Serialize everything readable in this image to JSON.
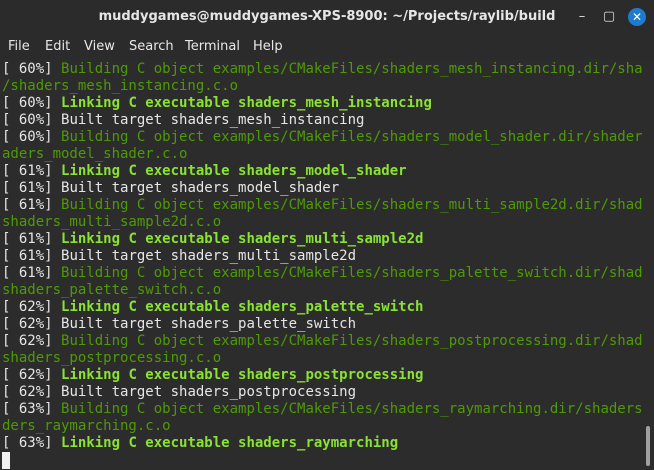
{
  "window": {
    "title": "muddygames@muddygames-XPS-8900: ~/Projects/raylib/build"
  },
  "buttons": {
    "minimize": "–",
    "maximize": "▢",
    "close": "✕"
  },
  "menu": [
    "File",
    "Edit",
    "View",
    "Search",
    "Terminal",
    "Help"
  ],
  "lines": [
    {
      "prefix": "[ 60%] ",
      "text": "Building C object examples/CMakeFiles/shaders_mesh_instancing.dir/shaders"
    },
    {
      "prefix": "",
      "text": "/shaders_mesh_instancing.c.o"
    },
    {
      "prefix": "[ 60%] ",
      "text": "Linking C executable shaders_mesh_instancing"
    },
    {
      "prefix": "[ 60%] ",
      "text": "Built target shaders_mesh_instancing"
    },
    {
      "prefix": "[ 60%] ",
      "text": "Building C object examples/CMakeFiles/shaders_model_shader.dir/shaders/sh"
    },
    {
      "prefix": "",
      "text": "aders_model_shader.c.o"
    },
    {
      "prefix": "[ 61%] ",
      "text": "Linking C executable shaders_model_shader"
    },
    {
      "prefix": "[ 61%] ",
      "text": "Built target shaders_model_shader"
    },
    {
      "prefix": "[ 61%] ",
      "text": "Building C object examples/CMakeFiles/shaders_multi_sample2d.dir/shaders/"
    },
    {
      "prefix": "",
      "text": "shaders_multi_sample2d.c.o"
    },
    {
      "prefix": "[ 61%] ",
      "text": "Linking C executable shaders_multi_sample2d"
    },
    {
      "prefix": "[ 61%] ",
      "text": "Built target shaders_multi_sample2d"
    },
    {
      "prefix": "[ 61%] ",
      "text": "Building C object examples/CMakeFiles/shaders_palette_switch.dir/shaders/"
    },
    {
      "prefix": "",
      "text": "shaders_palette_switch.c.o"
    },
    {
      "prefix": "[ 62%] ",
      "text": "Linking C executable shaders_palette_switch"
    },
    {
      "prefix": "[ 62%] ",
      "text": "Built target shaders_palette_switch"
    },
    {
      "prefix": "[ 62%] ",
      "text": "Building C object examples/CMakeFiles/shaders_postprocessing.dir/shaders/"
    },
    {
      "prefix": "",
      "text": "shaders_postprocessing.c.o"
    },
    {
      "prefix": "[ 62%] ",
      "text": "Linking C executable shaders_postprocessing"
    },
    {
      "prefix": "[ 62%] ",
      "text": "Built target shaders_postprocessing"
    },
    {
      "prefix": "[ 63%] ",
      "text": "Building C object examples/CMakeFiles/shaders_raymarching.dir/shaders/sha"
    },
    {
      "prefix": "",
      "text": "ders_raymarching.c.o"
    },
    {
      "prefix": "[ 63%] ",
      "text": "Linking C executable shaders_raymarching"
    }
  ],
  "colors": {
    "building": "#4e9a06",
    "linking": "#8ae234",
    "normal": "#e6e6e6",
    "background": "#2c2c2c",
    "close_button": "#1e7bd0"
  }
}
